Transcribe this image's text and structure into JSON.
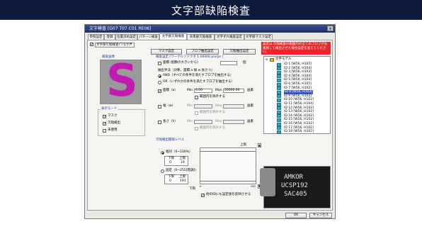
{
  "banner": {
    "title": "文字部缺陥検査"
  },
  "dialog": {
    "title": "文字検査 [G07 T07 C01 RE06]",
    "close": "x",
    "tabs": [
      "参照設定",
      "登録",
      "位置決め設定",
      "パターン検査",
      "文字部欠陥検査",
      "背景部欠陥検査",
      "文字ずれ検査設定",
      "文字部マスク設定"
    ],
    "target_select": "文字部欠陥検査(ワなか)",
    "buttons": {
      "mask": "マスク設定",
      "blob": "ブロブ抽出設定",
      "detect": "欠陥抽出設定"
    },
    "preview_label": "検査画像",
    "display_mode": {
      "legend": "表示モード",
      "items": [
        "マスク",
        "欠陥検出",
        "未使用"
      ]
    },
    "params": {
      "header": "検査設定 [ワークルファクタ 1.00000 pix/px ]",
      "size_label": "面積 (個数の大きいから)",
      "size_value": "",
      "size_unit": "個",
      "extract_label": "抽出手法（対象，面積 a 幅 w 長さ h）",
      "and_label": "AND（すべての条件を満たすブロブを抽出する）",
      "or_label": "OR（いずれかの条件を満たすブロブを抽出する）",
      "area": {
        "label": "面積（a）",
        "min_label": "Min",
        "min": "0.00",
        "max_label": "Max",
        "max": "20000.00",
        "unit": "画素"
      },
      "area_range": "範囲内を除外する",
      "width": {
        "label": "幅（w）",
        "min_label": "Min",
        "max_label": "Max",
        "unit": "画素"
      },
      "width_range": "範囲内を除外する",
      "length": {
        "label": "長さ（h）",
        "min_label": "Min",
        "max_label": "Max",
        "unit": "画素"
      },
      "length_range": "範囲内を除外する"
    },
    "threshold": {
      "header": "欠陥検出閾値レベル",
      "upper": "上限",
      "lower": "下限",
      "relative_label": "相対（0~100%）",
      "rel_cols": [
        "下限",
        "上限"
      ],
      "rel_vals": [
        "0",
        "19"
      ],
      "fixed_label": "固定（0~255[階調]）",
      "fix_cols": [
        "下限",
        "上限"
      ],
      "fix_vals": [
        "0",
        "191"
      ],
      "axis_min": "0",
      "axis_max": "255",
      "apply_label": "他のIDにも設定値を反映させる"
    },
    "warning": "設定は 欠陥検査の範囲内の全てのブロブがお連続して検出させた場合設定を変えてください。",
    "tree": {
      "root": "文字モデル",
      "items": [
        "ID 1 [W56, H105]",
        "ID 2 [W56, H104]",
        "ID 3 [W56, H103]",
        "ID 4 [W56, H104]",
        "ID 5 [W56, H104]",
        "ID 6 [W56, H105]",
        "ID 7 [W56, H102]",
        "ID 8 [W56, H103]",
        "ID 9 [W56, H102]",
        "ID 10 [W56, H102]",
        "ID 11 [W56, H104]",
        "ID 12 [W56, H102]",
        "ID 13 [W56, H102]",
        "ID 14 [W56, H102]",
        "ID 15 [W56, H102]",
        "ID 16 [W56, H102]",
        "ID 17 [W56, H102]",
        "ID 18 [W56, H102]"
      ],
      "selected": 7
    },
    "chip_text": [
      "AMKOR",
      "UCSP192",
      "SAC405"
    ],
    "ok": "OK",
    "cancel": "キャンセル",
    "colors": {
      "accent": "#1d3f9e",
      "warning": "#e8262b",
      "glyph": "#c21bb4"
    }
  }
}
